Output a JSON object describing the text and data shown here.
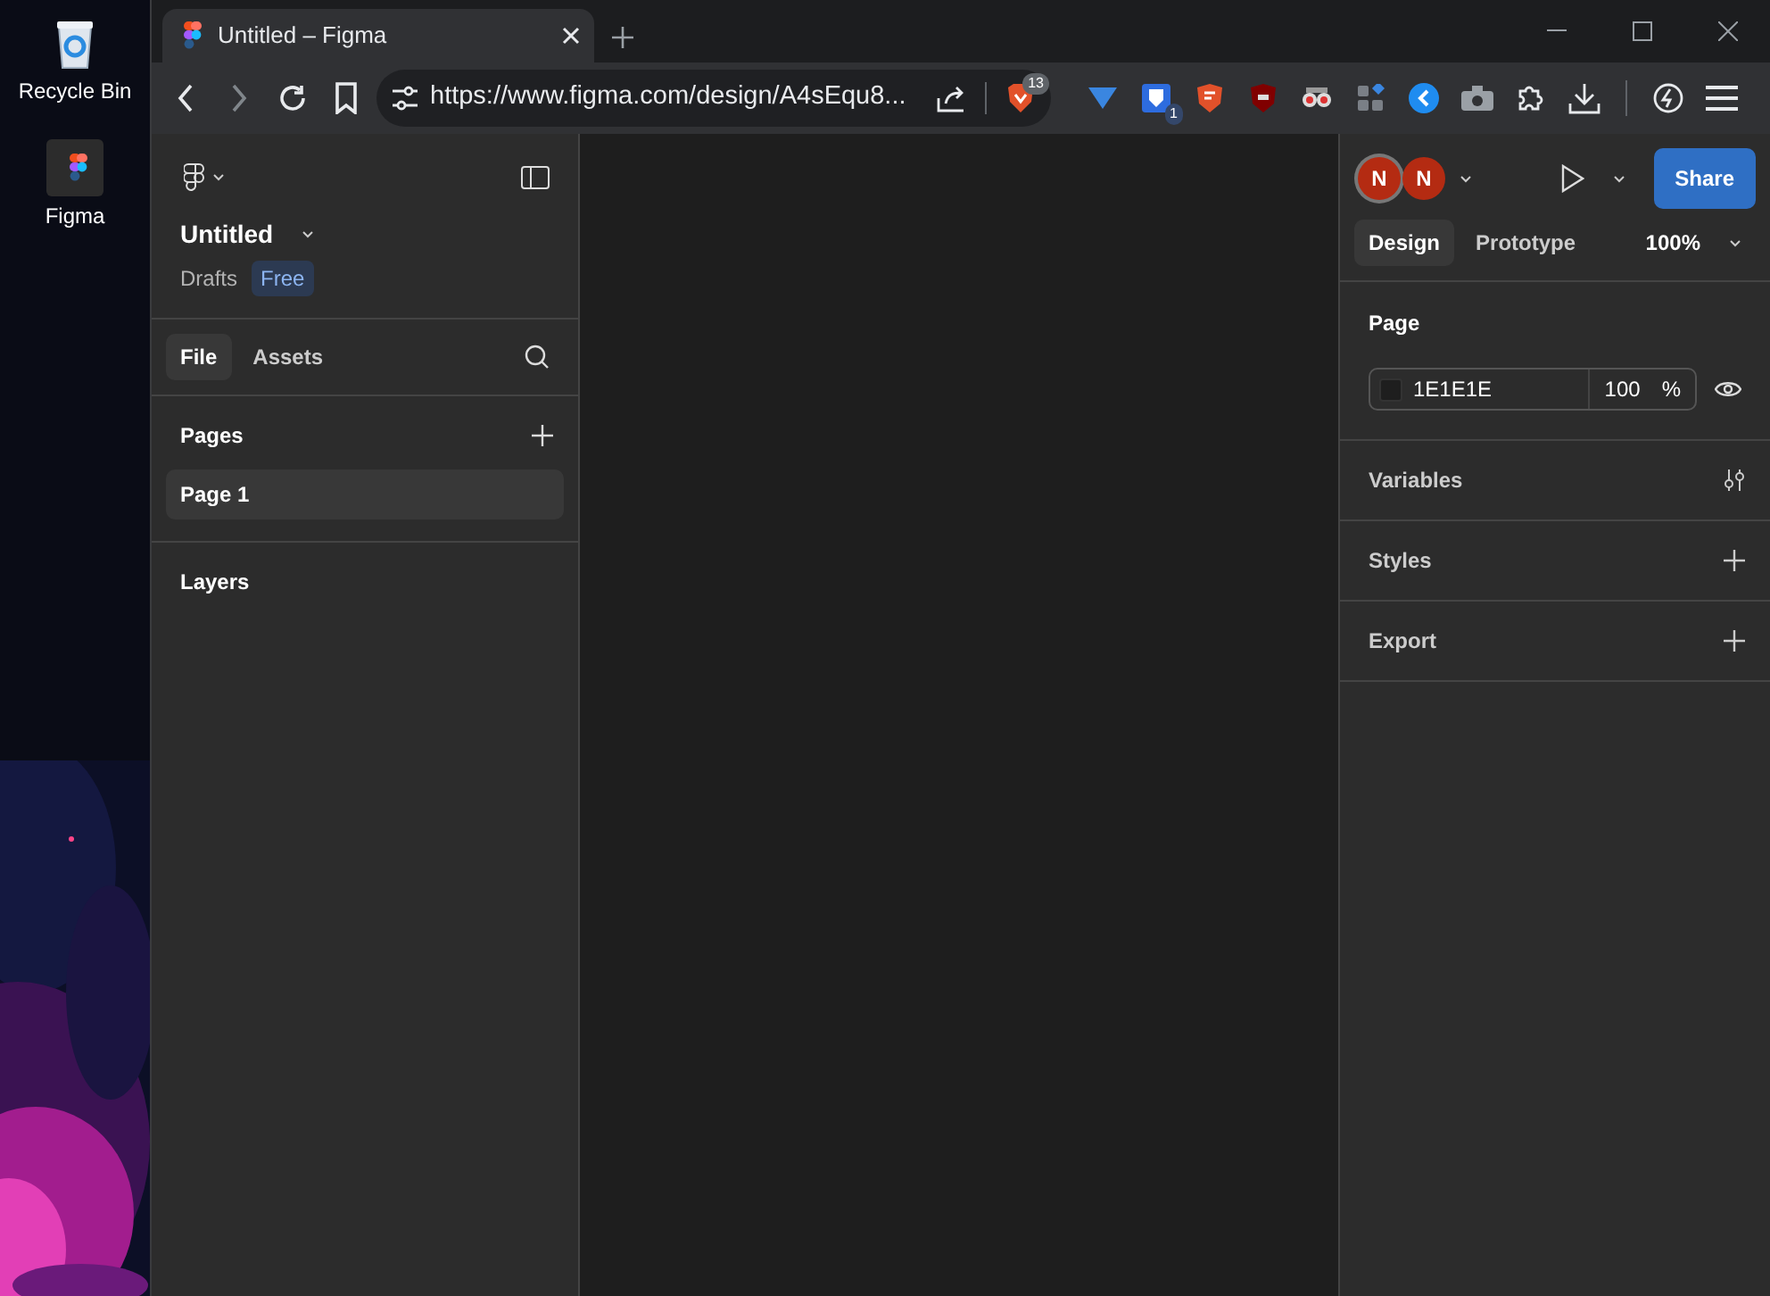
{
  "desktop": {
    "icons": [
      {
        "label": "Recycle Bin",
        "kind": "bin",
        "selected": false
      },
      {
        "label": "Figma",
        "kind": "figma",
        "selected": true
      }
    ]
  },
  "browser": {
    "tab": {
      "title": "Untitled – Figma"
    },
    "url": "https://www.figma.com/design/A4sEqu8...",
    "shields_count": "13",
    "extension_badge": "1"
  },
  "left_panel": {
    "file_name": "Untitled",
    "location": "Drafts",
    "plan_badge": "Free",
    "tabs": [
      {
        "label": "File",
        "selected": true
      },
      {
        "label": "Assets",
        "selected": false
      }
    ],
    "pages_header": "Pages",
    "pages": [
      {
        "name": "Page 1",
        "selected": true
      }
    ],
    "layers_header": "Layers"
  },
  "right_panel": {
    "avatars": [
      {
        "initial": "N",
        "outlined": true
      },
      {
        "initial": "N",
        "outlined": false
      }
    ],
    "share_button": "Share",
    "tabs": [
      {
        "label": "Design",
        "selected": true
      },
      {
        "label": "Prototype",
        "selected": false
      }
    ],
    "zoom": "100%",
    "page_section": {
      "title": "Page",
      "color_hex": "1E1E1E",
      "opacity": "100",
      "unit": "%"
    },
    "sections": [
      {
        "title": "Variables",
        "kind": "settings"
      },
      {
        "title": "Styles",
        "kind": "add"
      },
      {
        "title": "Export",
        "kind": "add"
      }
    ]
  }
}
